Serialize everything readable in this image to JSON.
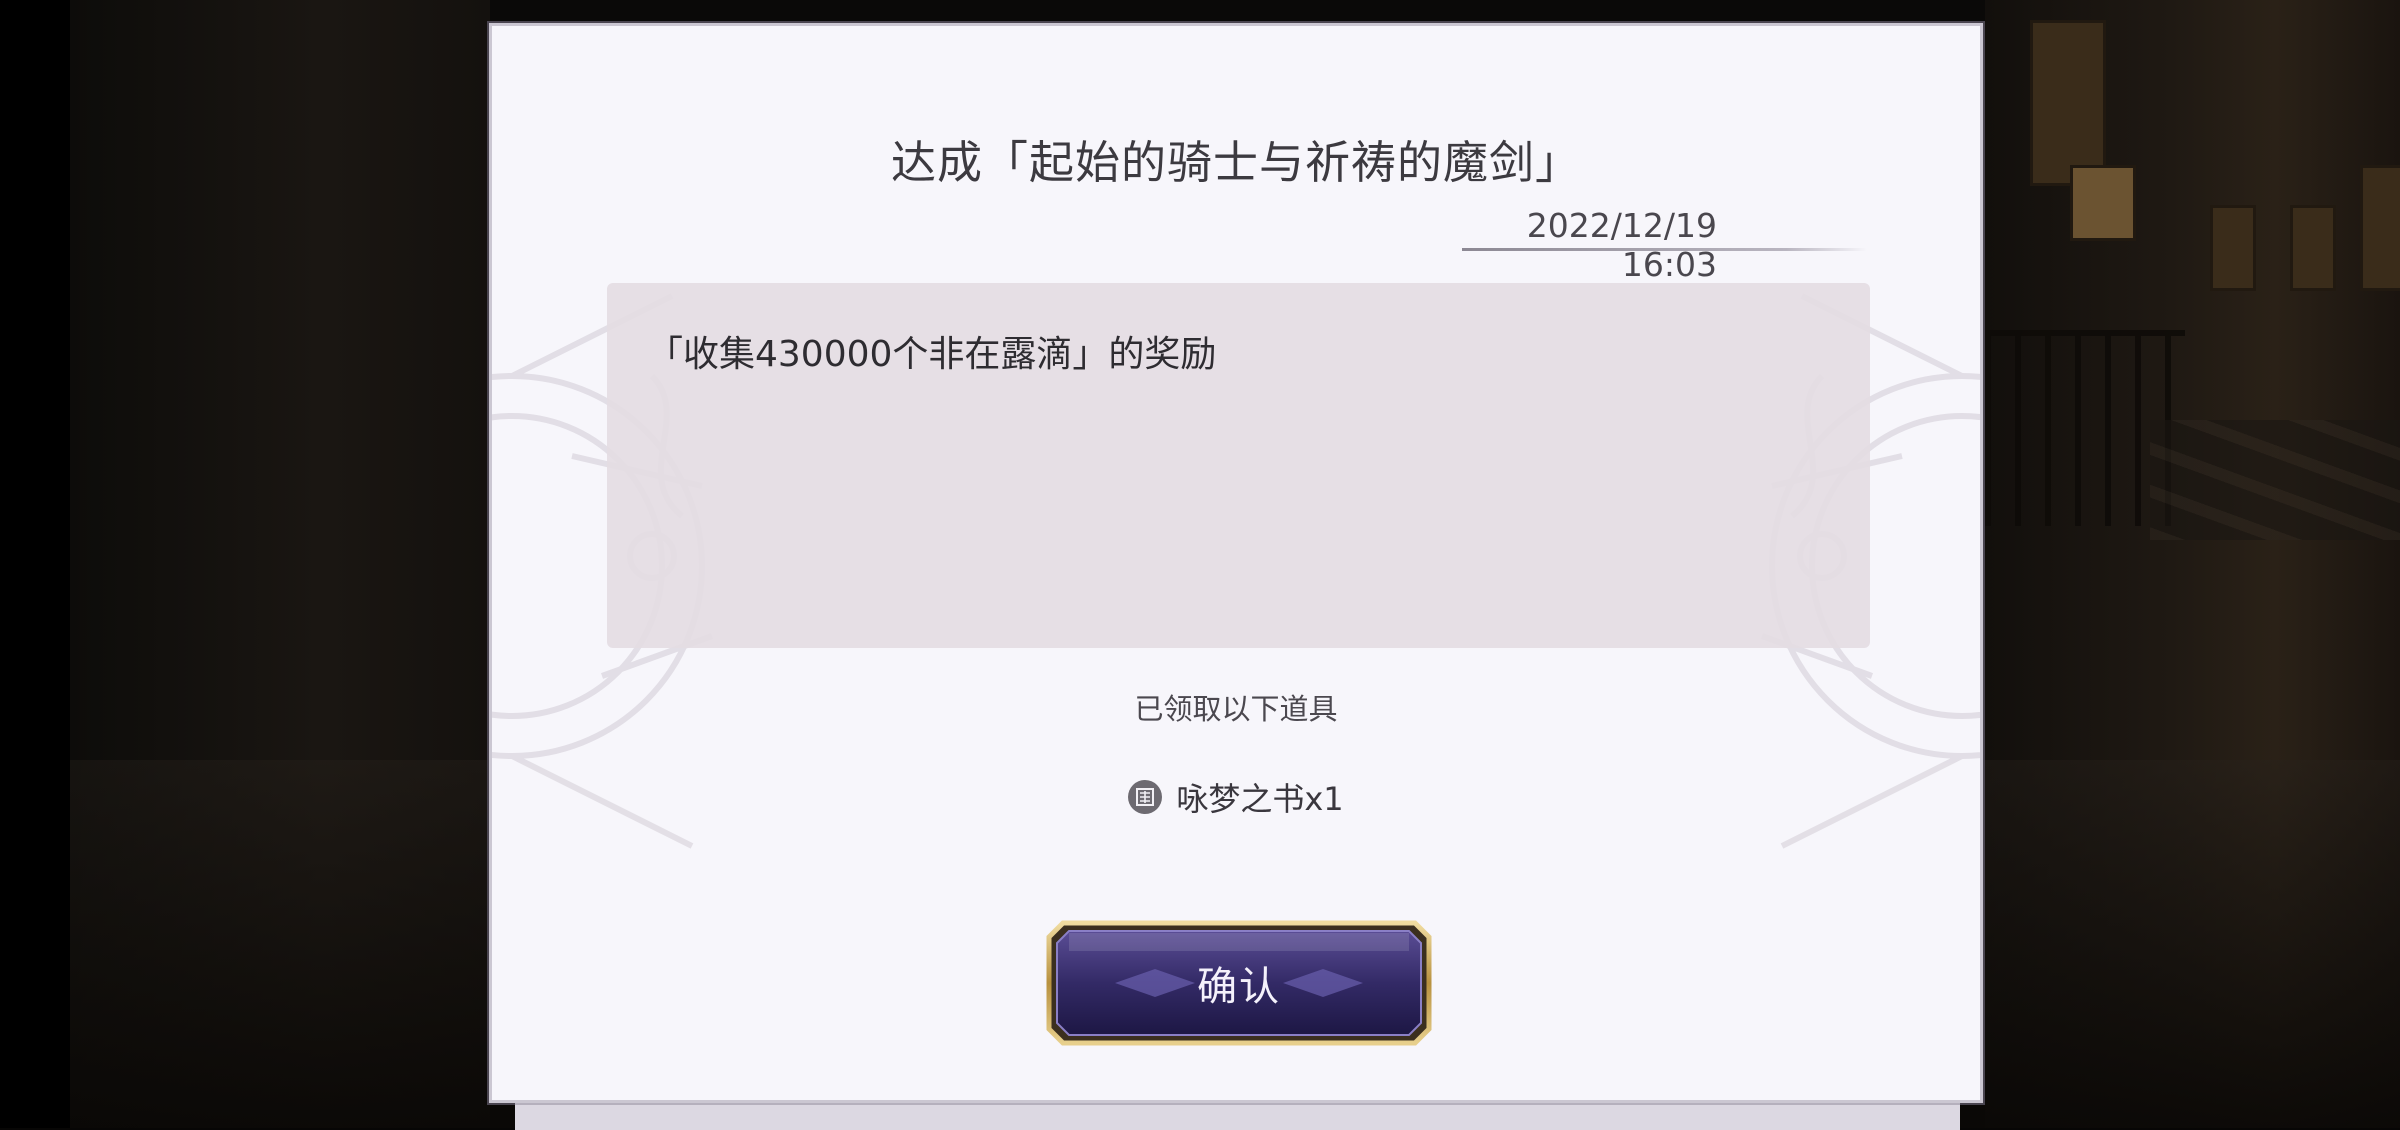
{
  "dialog": {
    "title": "达成「起始的骑士与祈祷的魔剑」",
    "date": "2022/12/19 16:03",
    "message": "「收集430000个非在露滴」的奖励",
    "received_label": "已领取以下道具",
    "items": [
      {
        "icon": "book-icon",
        "label": "咏梦之书x1"
      }
    ],
    "confirm_label": "确认"
  },
  "colors": {
    "dialog_bg": "#f7f6fb",
    "message_box_bg": "#e4dce3",
    "button_purple": "#3b3270",
    "button_gold": "#c9a85e"
  }
}
